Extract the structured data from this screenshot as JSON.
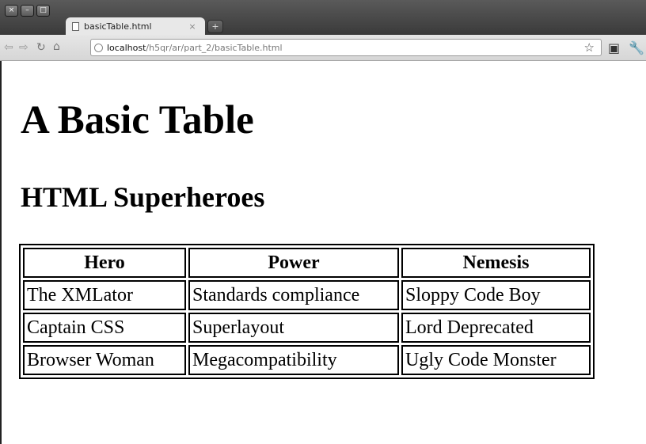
{
  "browser": {
    "tab_title": "basicTable.html",
    "tab_close": "×",
    "new_tab": "+",
    "url_host": "localhost",
    "url_path": "/h5qr/ar/part_2/basicTable.html"
  },
  "page": {
    "heading": "A Basic Table",
    "subheading": "HTML Superheroes"
  },
  "table": {
    "headers": [
      "Hero",
      "Power",
      "Nemesis"
    ],
    "rows": [
      [
        "The XMLator",
        "Standards compliance",
        "Sloppy Code Boy"
      ],
      [
        "Captain CSS",
        "Superlayout",
        "Lord Deprecated"
      ],
      [
        "Browser Woman",
        "Megacompatibility",
        "Ugly Code Monster"
      ]
    ]
  }
}
